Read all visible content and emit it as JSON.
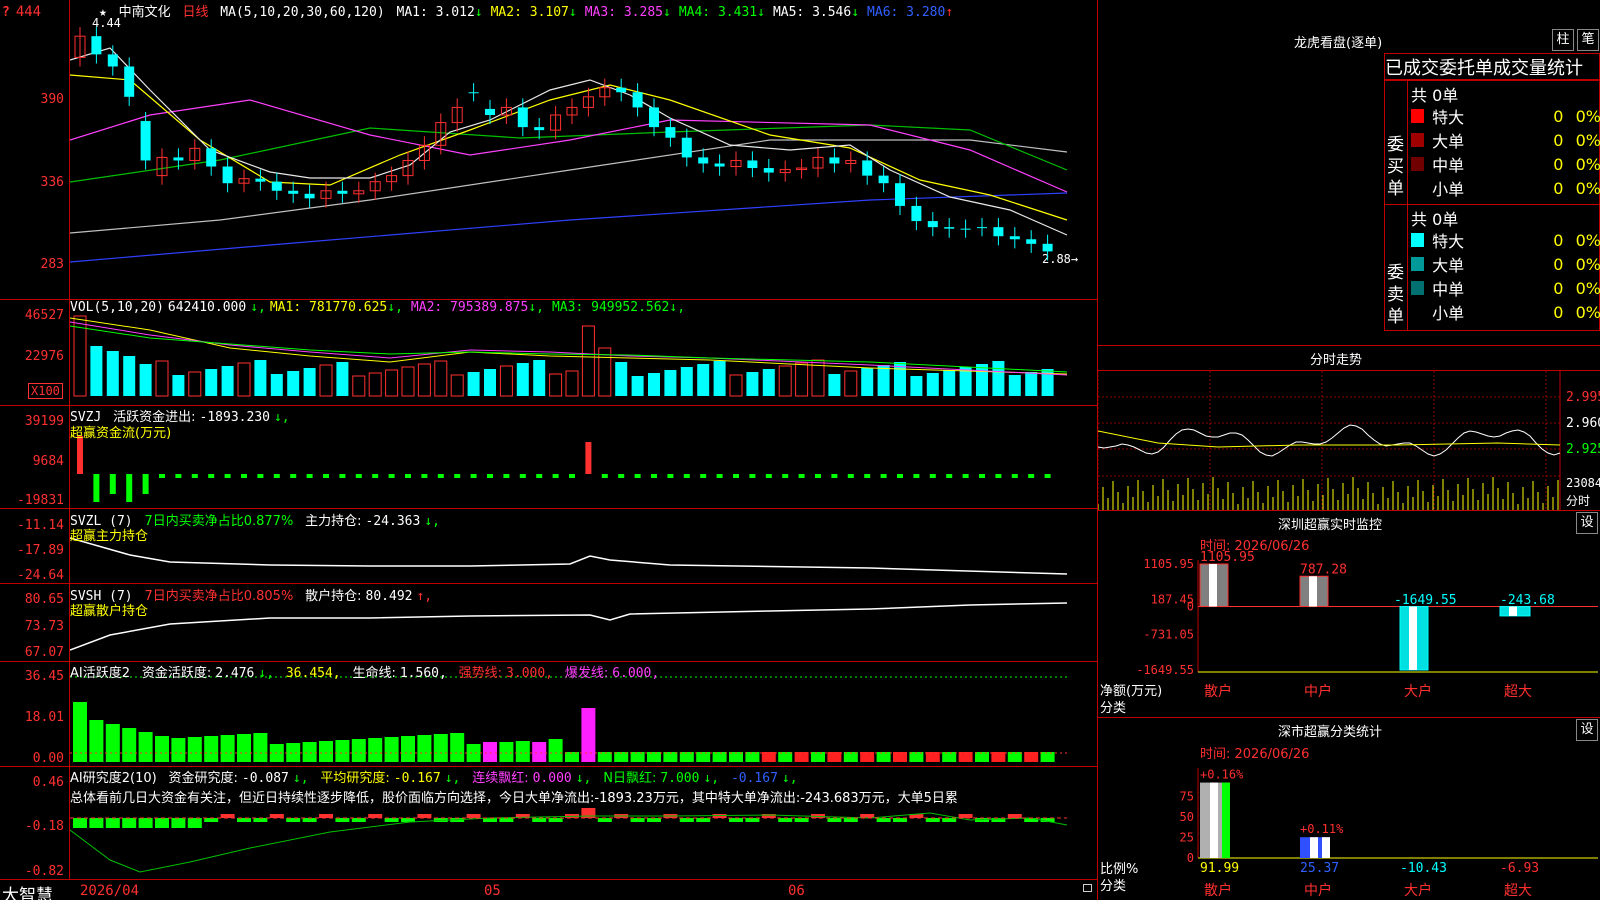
{
  "app_name": "大智慧",
  "main_chart": {
    "star": "★",
    "stock_name": "中南文化",
    "period": "日线",
    "ma_params": "MA(5,10,20,30,60,120)",
    "ma": [
      {
        "label": "MA1:",
        "value": "3.012",
        "arrow": "↓",
        "color": "#ffffff"
      },
      {
        "label": "MA2:",
        "value": "3.107",
        "arrow": "↓",
        "color": "#ffff00"
      },
      {
        "label": "MA3:",
        "value": "3.285",
        "arrow": "↓",
        "color": "#ff40ff"
      },
      {
        "label": "MA4:",
        "value": "3.431",
        "arrow": "↓",
        "color": "#00ff00"
      },
      {
        "label": "MA5:",
        "value": "3.546",
        "arrow": "↓",
        "color": "#ffffff"
      },
      {
        "label": "MA6:",
        "value": "3.280",
        "arrow": "↑",
        "color": "#3060ff"
      }
    ],
    "high_label": "4.44",
    "low_label": "2.88",
    "y_ticks": [
      "444",
      "390",
      "336",
      "283"
    ],
    "x_labels": [
      "2026/04",
      "05",
      "06"
    ]
  },
  "vol": {
    "title": "VOL(5,10,20)",
    "value": "642410.000",
    "arrow": "↓",
    "ma": [
      {
        "label": "MA1:",
        "value": "781770.625",
        "arrow": "↓",
        "color": "#ffff00"
      },
      {
        "label": "MA2:",
        "value": "795389.875",
        "arrow": "↓",
        "color": "#ff40ff"
      },
      {
        "label": "MA3:",
        "value": "949952.562",
        "arrow": "↓",
        "color": "#00ff00"
      }
    ],
    "y_ticks": [
      "46527",
      "22976"
    ],
    "unit": "X100"
  },
  "svzj": {
    "title": "SVZJ",
    "line1_label": "活跃资金进出:",
    "line1_value": "-1893.230",
    "line1_arrow": "↓,",
    "line2": "超赢资金流(万元)",
    "y_ticks": [
      "39199",
      "9684",
      "-19831"
    ]
  },
  "svzl": {
    "title": "SVZL (7)",
    "ratio_text": "7日内买卖净占比0.877%",
    "label": "主力持仓:",
    "value": "-24.363",
    "arrow": "↓,",
    "line2": "超赢主力持仓",
    "y_ticks": [
      "-11.14",
      "-17.89",
      "-24.64"
    ]
  },
  "svsh": {
    "title": "SVSH (7)",
    "ratio_text": "7日内买卖净占比0.805%",
    "label": "散户持仓:",
    "value": "80.492",
    "arrow": "↑,",
    "line2": "超赢散户持仓",
    "y_ticks": [
      "80.65",
      "73.73",
      "67.07"
    ]
  },
  "ai_active": {
    "title": "AI活跃度2",
    "l1": "资金活跃度:",
    "v1": "2.476",
    "a1": "↓,",
    "v2": "36.454,",
    "l3": "生命线:",
    "v3": "1.560,",
    "l4": "强势线:",
    "v4": "3.000,",
    "l5": "爆发线:",
    "v5": "6.000,",
    "y_ticks": [
      "36.45",
      "18.01",
      "0.00"
    ]
  },
  "ai_research": {
    "title": "AI研究度2(10)",
    "l1": "资金研究度:",
    "v1": "-0.087",
    "a1": "↓,",
    "l2": "平均研究度:",
    "v2": "-0.167",
    "a2": "↓,",
    "l3": "连续飘红:",
    "v3": "0.000",
    "a3": "↓,",
    "l4": "N日飘红:",
    "v4": "7.000",
    "a4": "↓,",
    "v5": "-0.167",
    "a5": "↓,",
    "summary": "总体看前几日大资金有关注，但近日持续性逐步降低，股价面临方向选择，今日大单净流出:-1893.23万元，其中特大单净流出:-243.683万元，大单5日累",
    "y_ticks": [
      "0.46",
      "-0.18",
      "-0.82"
    ]
  },
  "longhu": {
    "title": "龙虎看盘(逐单)",
    "btn1": "柱",
    "btn2": "笔",
    "header": "已成交委托单成交量统计",
    "buy_label": "委买单",
    "sell_label": "委卖单",
    "buy_total": "共 0单",
    "sell_total": "共 0单",
    "buy_rows": [
      {
        "name": "特大",
        "count": "0",
        "pct": "0%",
        "color": "#ff0000"
      },
      {
        "name": "大单",
        "count": "0",
        "pct": "0%",
        "color": "#a00000"
      },
      {
        "name": "中单",
        "count": "0",
        "pct": "0%",
        "color": "#700000"
      },
      {
        "name": "小单",
        "count": "0",
        "pct": "0%",
        "color": "#000000"
      }
    ],
    "sell_rows": [
      {
        "name": "特大",
        "count": "0",
        "pct": "0%",
        "color": "#00ffff"
      },
      {
        "name": "大单",
        "count": "0",
        "pct": "0%",
        "color": "#009a9a"
      },
      {
        "name": "中单",
        "count": "0",
        "pct": "0%",
        "color": "#007070"
      },
      {
        "name": "小单",
        "count": "0",
        "pct": "0%",
        "color": "#000000"
      }
    ]
  },
  "fenshi": {
    "title": "分时走势",
    "y_ticks": [
      "2.995",
      "2.960",
      "2.925"
    ],
    "vol_top": "23084",
    "vol_label": "分时"
  },
  "sz_monitor": {
    "title": "深圳超赢实时监控",
    "btn": "设",
    "time_label": "时间: 2026/06/26",
    "y_ticks": [
      "1105.95",
      "187.45",
      "0",
      "-731.05",
      "-1649.55"
    ],
    "axis_label_1": "净额(万元)",
    "axis_label_2": "分类",
    "categories": [
      "散户",
      "中户",
      "大户",
      "超大"
    ],
    "values": [
      1105.95,
      787.28,
      -1649.55,
      -243.68
    ],
    "value_labels": [
      "1105.95",
      "787.28",
      "-1649.55",
      "-243.68"
    ]
  },
  "sz_class": {
    "title": "深市超赢分类统计",
    "btn": "设",
    "time_label": "时间: 2026/06/26",
    "y_ticks": [
      "75",
      "50",
      "25",
      "0"
    ],
    "axis_label_1": "比例%",
    "axis_label_2": "分类",
    "categories": [
      "散户",
      "中户",
      "大户",
      "超大"
    ],
    "values": [
      91.99,
      25.37,
      -10.43,
      -6.93
    ],
    "value_labels": [
      "91.99",
      "25.37",
      "-10.43",
      "-6.93"
    ],
    "change_labels": [
      "+0.16%",
      "+0.11%"
    ]
  }
}
